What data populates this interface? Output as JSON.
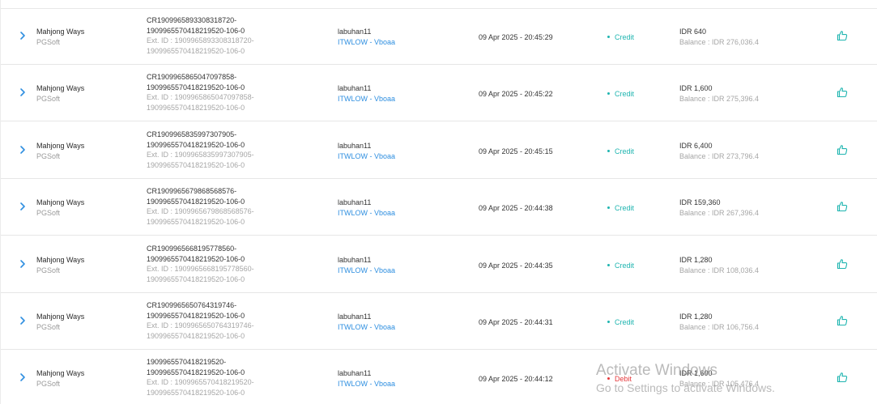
{
  "rows": [
    {
      "game": "Mahjong Ways",
      "provider": "PGSoft",
      "txn_line1": "CR1909965893308318720-",
      "txn_line2": "1909965570418219520-106-0",
      "ext_line1": "Ext. ID : 1909965893308318720-",
      "ext_line2": "1909965570418219520-106-0",
      "player": "labuhan11",
      "player_sub": "ITWLOW - Vboaa",
      "datetime": "09 Apr 2025 - 20:45:29",
      "type": "Credit",
      "amount": "IDR 640",
      "balance": "Balance : IDR 276,036.4"
    },
    {
      "game": "Mahjong Ways",
      "provider": "PGSoft",
      "txn_line1": "CR1909965865047097858-",
      "txn_line2": "1909965570418219520-106-0",
      "ext_line1": "Ext. ID : 1909965865047097858-",
      "ext_line2": "1909965570418219520-106-0",
      "player": "labuhan11",
      "player_sub": "ITWLOW - Vboaa",
      "datetime": "09 Apr 2025 - 20:45:22",
      "type": "Credit",
      "amount": "IDR 1,600",
      "balance": "Balance : IDR 275,396.4"
    },
    {
      "game": "Mahjong Ways",
      "provider": "PGSoft",
      "txn_line1": "CR1909965835997307905-",
      "txn_line2": "1909965570418219520-106-0",
      "ext_line1": "Ext. ID : 1909965835997307905-",
      "ext_line2": "1909965570418219520-106-0",
      "player": "labuhan11",
      "player_sub": "ITWLOW - Vboaa",
      "datetime": "09 Apr 2025 - 20:45:15",
      "type": "Credit",
      "amount": "IDR 6,400",
      "balance": "Balance : IDR 273,796.4"
    },
    {
      "game": "Mahjong Ways",
      "provider": "PGSoft",
      "txn_line1": "CR1909965679868568576-",
      "txn_line2": "1909965570418219520-106-0",
      "ext_line1": "Ext. ID : 1909965679868568576-",
      "ext_line2": "1909965570418219520-106-0",
      "player": "labuhan11",
      "player_sub": "ITWLOW - Vboaa",
      "datetime": "09 Apr 2025 - 20:44:38",
      "type": "Credit",
      "amount": "IDR 159,360",
      "balance": "Balance : IDR 267,396.4"
    },
    {
      "game": "Mahjong Ways",
      "provider": "PGSoft",
      "txn_line1": "CR1909965668195778560-",
      "txn_line2": "1909965570418219520-106-0",
      "ext_line1": "Ext. ID : 1909965668195778560-",
      "ext_line2": "1909965570418219520-106-0",
      "player": "labuhan11",
      "player_sub": "ITWLOW - Vboaa",
      "datetime": "09 Apr 2025 - 20:44:35",
      "type": "Credit",
      "amount": "IDR 1,280",
      "balance": "Balance : IDR 108,036.4"
    },
    {
      "game": "Mahjong Ways",
      "provider": "PGSoft",
      "txn_line1": "CR1909965650764319746-",
      "txn_line2": "1909965570418219520-106-0",
      "ext_line1": "Ext. ID : 1909965650764319746-",
      "ext_line2": "1909965570418219520-106-0",
      "player": "labuhan11",
      "player_sub": "ITWLOW - Vboaa",
      "datetime": "09 Apr 2025 - 20:44:31",
      "type": "Credit",
      "amount": "IDR 1,280",
      "balance": "Balance : IDR 106,756.4"
    },
    {
      "game": "Mahjong Ways",
      "provider": "PGSoft",
      "txn_line1": "1909965570418219520-",
      "txn_line2": "1909965570418219520-106-0",
      "ext_line1": "Ext. ID : 1909965570418219520-",
      "ext_line2": "1909965570418219520-106-0",
      "player": "labuhan11",
      "player_sub": "ITWLOW - Vboaa",
      "datetime": "09 Apr 2025 - 20:44:12",
      "type": "Debit",
      "amount": "IDR 1,600",
      "balance": "Balance : IDR 105,476.4"
    }
  ],
  "watermark": {
    "line1": "Activate Windows",
    "line2": "Go to Settings to activate Windows."
  },
  "colors": {
    "credit": "#1fb5b0",
    "debit": "#e5383b",
    "link": "#2f8fe0",
    "chevron": "#2f8fe0",
    "thumb": "#1fb5b0"
  },
  "icons": {
    "expand": "chevron-right-icon",
    "action": "thumbs-up-icon"
  }
}
